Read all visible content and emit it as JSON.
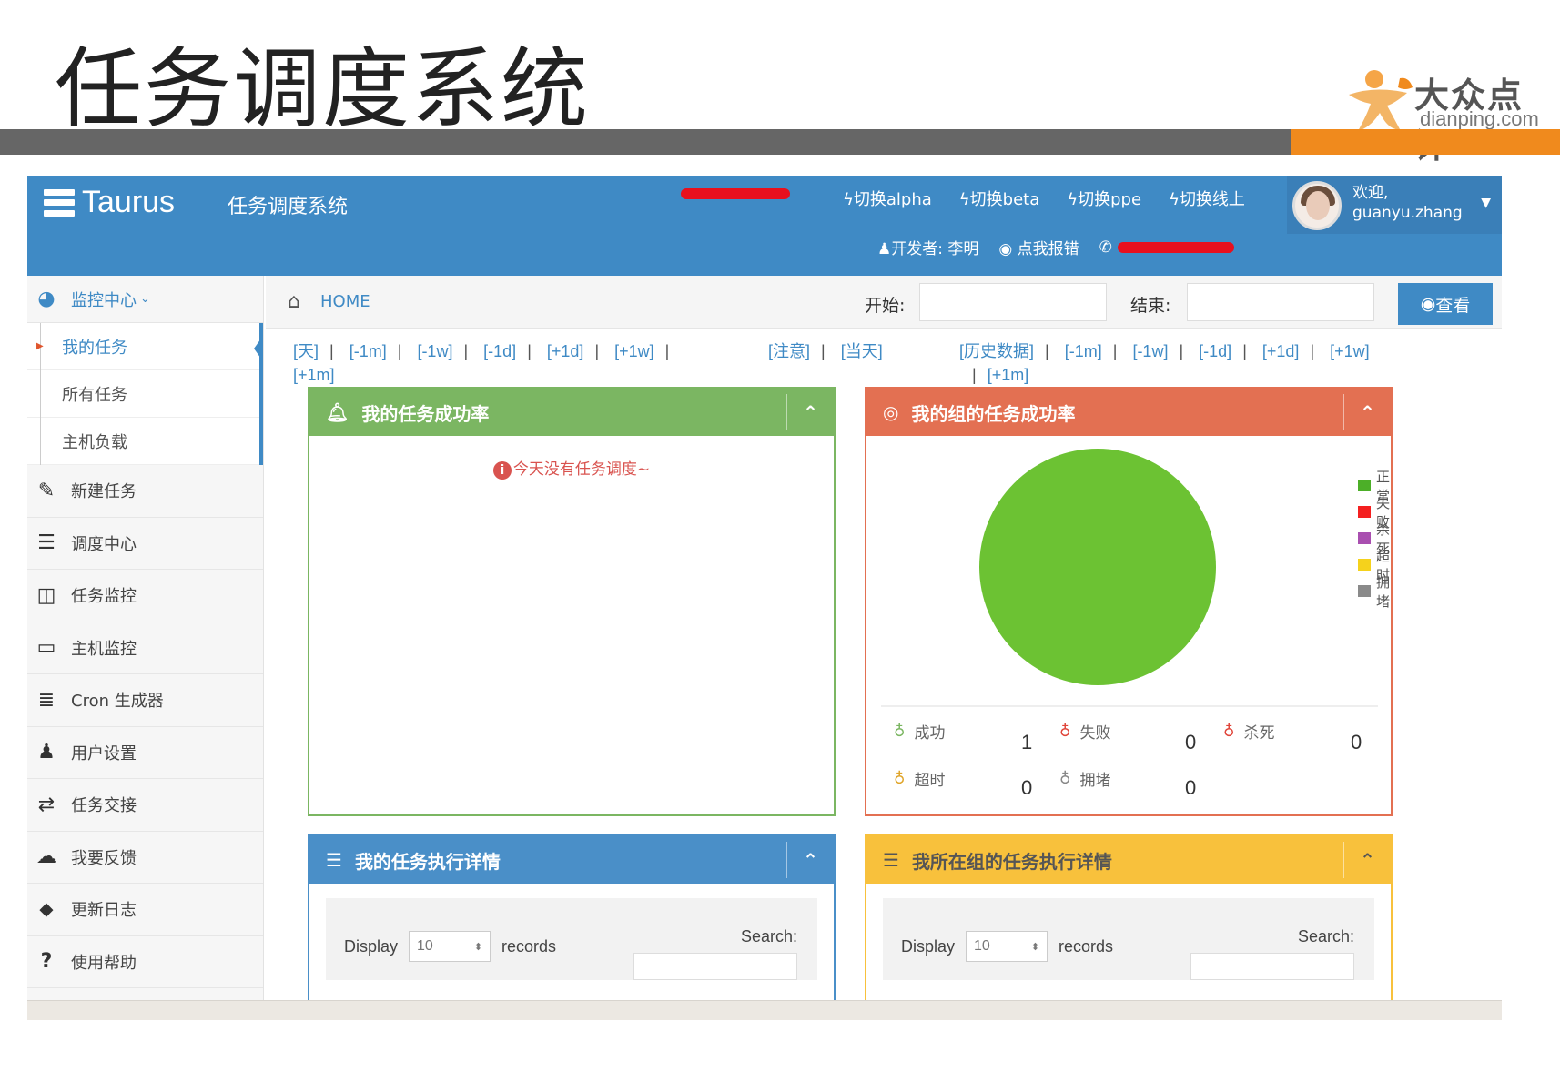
{
  "slide": {
    "title": "任务调度系统",
    "logo_cn": "大众点评",
    "logo_en": "dianping.com",
    "colors": {
      "bar": "#666666",
      "accent": "#f08a1d"
    }
  },
  "header": {
    "brand": "Taurus",
    "subtitle": "任务调度系统",
    "env_links": [
      "切换alpha",
      "切换beta",
      "切换ppe",
      "切换线上"
    ],
    "user_greeting": "欢迎,",
    "user_name": "guanyu.zhang",
    "developer": "开发者: 李明",
    "report": "点我报错",
    "accent": "#3f8ac5"
  },
  "sidebar": {
    "group_label": "监控中心",
    "sub_items": [
      "我的任务",
      "所有任务",
      "主机负载"
    ],
    "items": [
      {
        "icon": "edit-icon",
        "label": "新建任务"
      },
      {
        "icon": "server-icon",
        "label": "调度中心"
      },
      {
        "icon": "board-icon",
        "label": "任务监控"
      },
      {
        "icon": "monitor-icon",
        "label": "主机监控"
      },
      {
        "icon": "list-icon",
        "label": "Cron 生成器"
      },
      {
        "icon": "user-icon",
        "label": "用户设置"
      },
      {
        "icon": "retweet-icon",
        "label": "任务交接"
      },
      {
        "icon": "comments-icon",
        "label": "我要反馈"
      },
      {
        "icon": "tag-icon",
        "label": "更新日志"
      },
      {
        "icon": "question-icon",
        "label": "使用帮助"
      }
    ]
  },
  "toolbar": {
    "home": "HOME",
    "start_label": "开始:",
    "end_label": "结束:",
    "view_button": "查看"
  },
  "ranges": {
    "left": [
      "[天]",
      "[-1m]",
      "[-1w]",
      "[-1d]",
      "[+1d]",
      "[+1w]"
    ],
    "left_wrap": "[+1m]",
    "middle": [
      "[注意]",
      "[当天]"
    ],
    "right": [
      "[历史数据]",
      "[-1m]",
      "[-1w]",
      "[-1d]",
      "[+1d]",
      "[+1w]"
    ],
    "right_wrap": "[+1m]"
  },
  "panels": {
    "my_success": {
      "title": "我的任务成功率",
      "message": "今天没有任务调度~",
      "color": "#7bb662"
    },
    "group_success": {
      "title": "我的组的任务成功率",
      "color": "#e37052",
      "legend": [
        {
          "label": "正常",
          "color": "#4caf28"
        },
        {
          "label": "失败",
          "color": "#f42020"
        },
        {
          "label": "杀死",
          "color": "#a94fb0"
        },
        {
          "label": "超时",
          "color": "#f5d21c"
        },
        {
          "label": "拥堵",
          "color": "#8a8a8a"
        }
      ],
      "stats": [
        {
          "label": "成功",
          "value": "1",
          "bulb_color": "#7bb662"
        },
        {
          "label": "失败",
          "value": "0",
          "bulb_color": "#e0453a"
        },
        {
          "label": "杀死",
          "value": "0",
          "bulb_color": "#e0453a"
        },
        {
          "label": "超时",
          "value": "0",
          "bulb_color": "#e0a52a"
        },
        {
          "label": "拥堵",
          "value": "0",
          "bulb_color": "#888888"
        }
      ]
    },
    "my_details": {
      "title": "我的任务执行详情",
      "color": "#4a8fc8"
    },
    "group_details": {
      "title": "我所在组的任务执行详情",
      "color": "#f8c13c"
    },
    "table": {
      "display": "Display",
      "page_size": "10",
      "records": "records",
      "search": "Search:"
    }
  },
  "chart_data": {
    "type": "pie",
    "categories": [
      "正常",
      "失败",
      "杀死",
      "超时",
      "拥堵"
    ],
    "values": [
      1,
      0,
      0,
      0,
      0
    ],
    "colors": [
      "#6cc233",
      "#f42020",
      "#a94fb0",
      "#f5d21c",
      "#8a8a8a"
    ],
    "legend": "right"
  }
}
